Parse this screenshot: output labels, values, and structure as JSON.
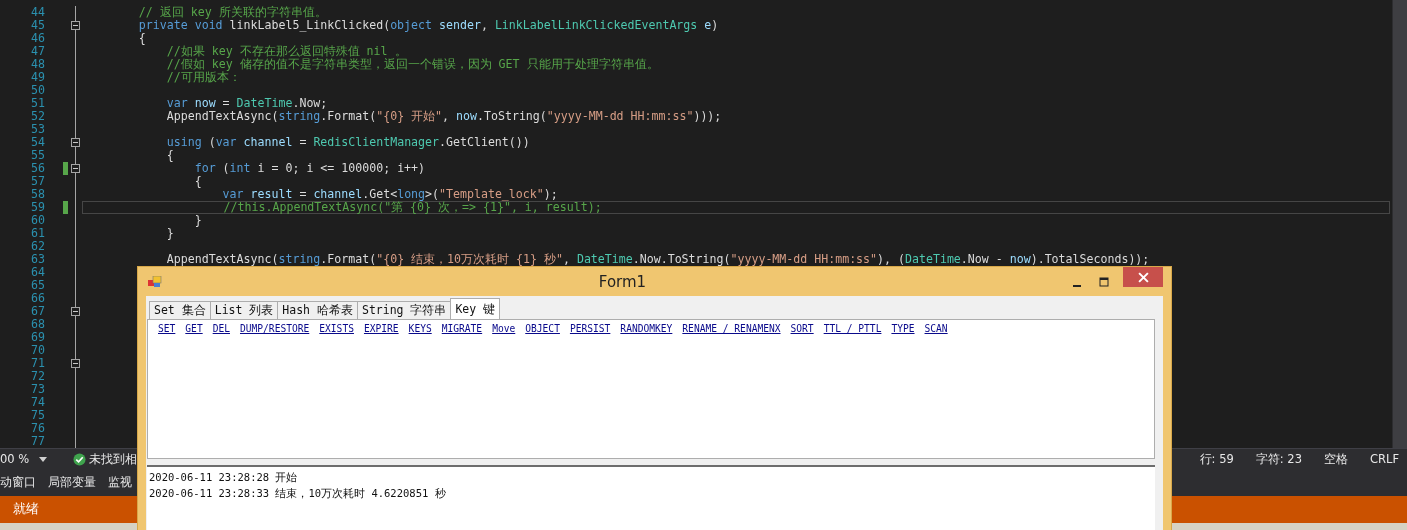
{
  "editor": {
    "lines": [
      {
        "number": "44",
        "code": [
          {
            "kind": "comment",
            "text": "        // 返回 key 所关联的字符串值。"
          }
        ],
        "changed": false,
        "collapsible": false,
        "current": false
      },
      {
        "number": "45",
        "code": [
          {
            "kind": "keyword",
            "text": "        private void"
          },
          {
            "kind": "plain",
            "text": " linkLabel5_LinkClicked("
          },
          {
            "kind": "keyword",
            "text": "object"
          },
          {
            "kind": "var",
            "text": " sender"
          },
          {
            "kind": "plain",
            "text": ", "
          },
          {
            "kind": "type",
            "text": "LinkLabelLinkClickedEventArgs"
          },
          {
            "kind": "var",
            "text": " e"
          },
          {
            "kind": "plain",
            "text": ")"
          }
        ],
        "changed": false,
        "collapsible": true,
        "current": false
      },
      {
        "number": "46",
        "code": [
          {
            "kind": "plain",
            "text": "        {"
          }
        ],
        "changed": false,
        "collapsible": false,
        "current": false
      },
      {
        "number": "47",
        "code": [
          {
            "kind": "comment",
            "text": "            //如果 key 不存在那么返回特殊值 nil 。"
          }
        ],
        "changed": false,
        "collapsible": false,
        "current": false
      },
      {
        "number": "48",
        "code": [
          {
            "kind": "comment",
            "text": "            //假如 key 储存的值不是字符串类型，返回一个错误，因为 GET 只能用于处理字符串值。"
          }
        ],
        "changed": false,
        "collapsible": false,
        "current": false
      },
      {
        "number": "49",
        "code": [
          {
            "kind": "comment",
            "text": "            //可用版本："
          }
        ],
        "changed": false,
        "collapsible": false,
        "current": false
      },
      {
        "number": "50",
        "changed": false,
        "collapsible": false,
        "current": false
      },
      {
        "number": "51",
        "code": [
          {
            "kind": "keyword",
            "text": "            var"
          },
          {
            "kind": "var",
            "text": " now"
          },
          {
            "kind": "plain",
            "text": " = "
          },
          {
            "kind": "type",
            "text": "DateTime"
          },
          {
            "kind": "plain",
            "text": ".Now;"
          }
        ],
        "changed": false,
        "collapsible": false,
        "current": false
      },
      {
        "number": "52",
        "code": [
          {
            "kind": "plain",
            "text": "            AppendTextAsync("
          },
          {
            "kind": "keyword",
            "text": "string"
          },
          {
            "kind": "plain",
            "text": ".Format("
          },
          {
            "kind": "string",
            "text": "\"{0} 开始\""
          },
          {
            "kind": "plain",
            "text": ", "
          },
          {
            "kind": "var",
            "text": "now"
          },
          {
            "kind": "plain",
            "text": ".ToString("
          },
          {
            "kind": "string",
            "text": "\"yyyy-MM-dd HH:mm:ss\""
          },
          {
            "kind": "plain",
            "text": ")));"
          }
        ],
        "changed": false,
        "collapsible": false,
        "current": false
      },
      {
        "number": "53",
        "changed": false,
        "collapsible": false,
        "current": false
      },
      {
        "number": "54",
        "code": [
          {
            "kind": "keyword",
            "text": "            using"
          },
          {
            "kind": "plain",
            "text": " ("
          },
          {
            "kind": "keyword",
            "text": "var"
          },
          {
            "kind": "var",
            "text": " channel"
          },
          {
            "kind": "plain",
            "text": " = "
          },
          {
            "kind": "type",
            "text": "RedisClientManager"
          },
          {
            "kind": "plain",
            "text": ".GetClient())"
          }
        ],
        "changed": false,
        "collapsible": true,
        "current": false
      },
      {
        "number": "55",
        "code": [
          {
            "kind": "plain",
            "text": "            {"
          }
        ],
        "changed": false,
        "collapsible": false,
        "current": false
      },
      {
        "number": "56",
        "code": [
          {
            "kind": "keyword",
            "text": "                for"
          },
          {
            "kind": "plain",
            "text": " ("
          },
          {
            "kind": "keyword",
            "text": "int"
          },
          {
            "kind": "plain",
            "text": " i = 0; i <= 100000; i++)"
          }
        ],
        "changed": true,
        "collapsible": true,
        "current": false
      },
      {
        "number": "57",
        "code": [
          {
            "kind": "plain",
            "text": "                {"
          }
        ],
        "changed": false,
        "collapsible": false,
        "current": false
      },
      {
        "number": "58",
        "code": [
          {
            "kind": "keyword",
            "text": "                    var"
          },
          {
            "kind": "var",
            "text": " result"
          },
          {
            "kind": "plain",
            "text": " = "
          },
          {
            "kind": "var",
            "text": "channel"
          },
          {
            "kind": "plain",
            "text": ".Get<"
          },
          {
            "kind": "keyword",
            "text": "long"
          },
          {
            "kind": "plain",
            "text": ">("
          },
          {
            "kind": "string",
            "text": "\"Template_lock\""
          },
          {
            "kind": "plain",
            "text": ");"
          }
        ],
        "changed": false,
        "collapsible": false,
        "current": false
      },
      {
        "number": "59",
        "code": [
          {
            "kind": "comment",
            "text": "                    //this.AppendTextAsync(\"第 {0} 次，=> {1}\", i, result);"
          }
        ],
        "changed": true,
        "collapsible": false,
        "current": true
      },
      {
        "number": "60",
        "code": [
          {
            "kind": "plain",
            "text": "                }"
          }
        ],
        "changed": false,
        "collapsible": false,
        "current": false
      },
      {
        "number": "61",
        "code": [
          {
            "kind": "plain",
            "text": "            }"
          }
        ],
        "changed": false,
        "collapsible": false,
        "current": false
      },
      {
        "number": "62",
        "changed": false,
        "collapsible": false,
        "current": false
      },
      {
        "number": "63",
        "code": [
          {
            "kind": "plain",
            "text": "            AppendTextAsync("
          },
          {
            "kind": "keyword",
            "text": "string"
          },
          {
            "kind": "plain",
            "text": ".Format("
          },
          {
            "kind": "string",
            "text": "\"{0} 结束，10万次耗时 {1} 秒\""
          },
          {
            "kind": "plain",
            "text": ", "
          },
          {
            "kind": "type",
            "text": "DateTime"
          },
          {
            "kind": "plain",
            "text": ".Now.ToString("
          },
          {
            "kind": "string",
            "text": "\"yyyy-MM-dd HH:mm:ss\""
          },
          {
            "kind": "plain",
            "text": "), ("
          },
          {
            "kind": "type",
            "text": "DateTime"
          },
          {
            "kind": "plain",
            "text": ".Now - "
          },
          {
            "kind": "var",
            "text": "now"
          },
          {
            "kind": "plain",
            "text": ").TotalSeconds));"
          }
        ],
        "changed": false,
        "collapsible": false,
        "current": false
      },
      {
        "number": "64",
        "changed": false,
        "collapsible": false,
        "current": false
      },
      {
        "number": "65",
        "changed": false,
        "collapsible": false,
        "current": false
      },
      {
        "number": "66",
        "changed": false,
        "collapsible": false,
        "current": false
      },
      {
        "number": "67",
        "changed": false,
        "collapsible": true,
        "current": false
      },
      {
        "number": "68",
        "changed": false,
        "collapsible": false,
        "current": false
      },
      {
        "number": "69",
        "changed": false,
        "collapsible": false,
        "current": false
      },
      {
        "number": "70",
        "changed": false,
        "collapsible": false,
        "current": false
      },
      {
        "number": "71",
        "changed": false,
        "collapsible": true,
        "current": false
      },
      {
        "number": "72",
        "changed": false,
        "collapsible": false,
        "current": false
      },
      {
        "number": "73",
        "changed": false,
        "collapsible": false,
        "current": false
      },
      {
        "number": "74",
        "changed": false,
        "collapsible": false,
        "current": false
      },
      {
        "number": "75",
        "changed": false,
        "collapsible": false,
        "current": false
      },
      {
        "number": "76",
        "changed": false,
        "collapsible": false,
        "current": false
      },
      {
        "number": "77",
        "changed": false,
        "collapsible": false,
        "current": false
      }
    ]
  },
  "status_bar": {
    "zoom": "00 %",
    "message": "未找到相",
    "line": "行: 59",
    "column": "字符: 23",
    "indent": "空格",
    "line_ending": "CRLF"
  },
  "tool_tabs": [
    "动窗口",
    "局部变量",
    "监视"
  ],
  "app_status": "就绪",
  "form": {
    "title": "Form1",
    "tabs": [
      {
        "label": "Set 集合",
        "selected": false
      },
      {
        "label": "List 列表",
        "selected": false
      },
      {
        "label": "Hash 哈希表",
        "selected": false
      },
      {
        "label": "String 字符串",
        "selected": false
      },
      {
        "label": "Key 键",
        "selected": true
      }
    ],
    "links": [
      "SET",
      "GET",
      "DEL",
      "DUMP/RESTORE",
      "EXISTS",
      "EXPIRE",
      "KEYS",
      "MIGRATE",
      "Move",
      "OBJECT",
      "PERSIST",
      "RANDOMKEY",
      "RENAME / RENAMENX",
      "SORT",
      "TTL / PTTL",
      "TYPE",
      "SCAN"
    ],
    "log": [
      "2020-06-11 23:28:28 开始",
      "2020-06-11 23:28:33 结束，10万次耗时 4.6220851 秒"
    ]
  }
}
